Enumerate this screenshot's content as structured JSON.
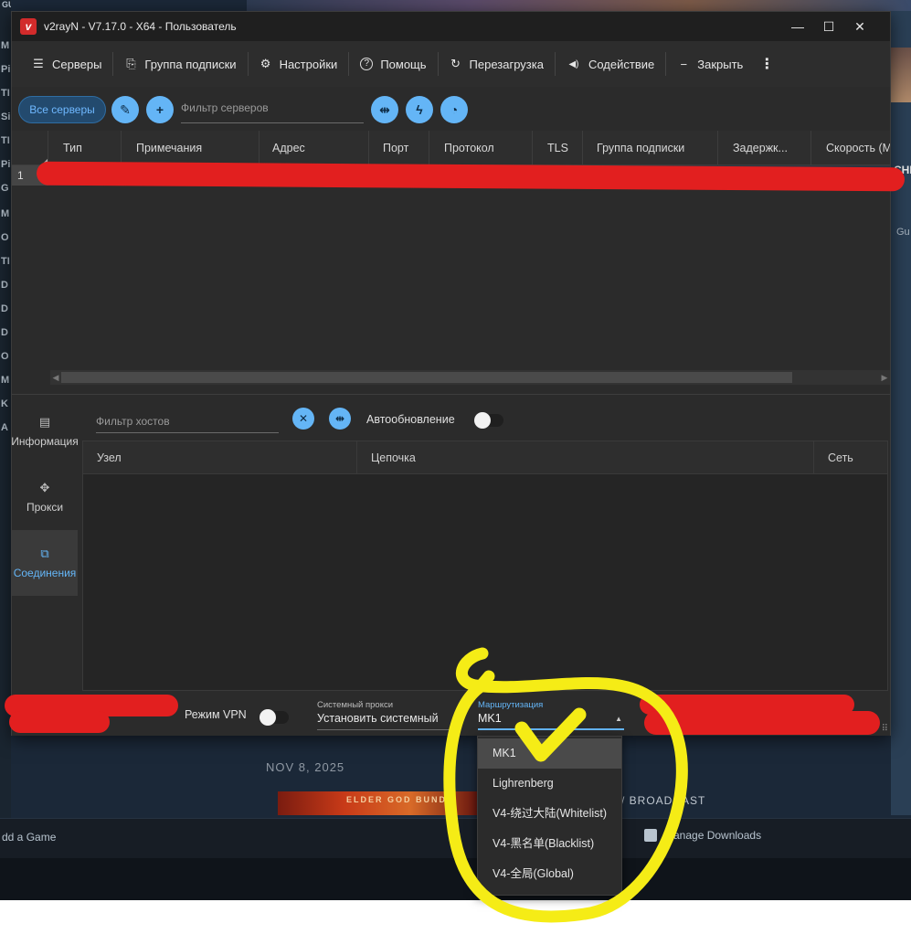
{
  "background": {
    "left_letters": [
      "M",
      "Pi",
      "TI",
      "Si",
      "TI",
      "Pi",
      "G",
      "M",
      "O",
      "TI",
      "D",
      "D",
      "D",
      "O",
      "M",
      "K",
      "A"
    ],
    "top_text": "GUILTY GEAR -STRIVE-",
    "right_partial_1": "CHI",
    "right_partial_2": "Gu",
    "date": "NOV 8, 2025",
    "card_text": "ELDER GOD BUND",
    "broadcast_text": "/ BROADCAST",
    "add_game": "dd a Game",
    "manage_downloads": "Manage Downloads"
  },
  "window": {
    "title": "v2rayN - V7.17.0 - X64 - Пользователь",
    "logo_letter": "v",
    "minimize": "—",
    "maximize": "☐",
    "close": "✕"
  },
  "toolbar": {
    "items": [
      {
        "label": "Серверы",
        "icon": "servers-icon",
        "glyph": "☰"
      },
      {
        "label": "Группа подписки",
        "icon": "subscription-icon",
        "glyph": "⎘"
      },
      {
        "label": "Настройки",
        "icon": "gear-icon",
        "glyph": "⚙"
      },
      {
        "label": "Помощь",
        "icon": "help-icon",
        "glyph": "?"
      },
      {
        "label": "Перезагрузка",
        "icon": "reload-icon",
        "glyph": "↻"
      },
      {
        "label": "Содействие",
        "icon": "speaker-icon",
        "glyph": "◀)"
      },
      {
        "label": "Закрыть",
        "icon": "minus-icon",
        "glyph": "−"
      }
    ],
    "more": "⋮"
  },
  "filterbar": {
    "all_servers": "Все серверы",
    "edit_glyph": "✎",
    "add_glyph": "+",
    "server_filter_placeholder": "Фильтр серверов",
    "move_glyph": "⇹",
    "speed_glyph": "ϟ",
    "gauge_glyph": "◔"
  },
  "servers_table": {
    "columns": [
      "Тип",
      "Примечания",
      "Адрес",
      "Порт",
      "Протокол",
      "TLS",
      "Группа подписки",
      "Задержк...",
      "Скорость (М"
    ],
    "rows": [
      {
        "index": "1"
      }
    ]
  },
  "sidenav": {
    "items": [
      {
        "label": "Информация",
        "icon": "info-icon",
        "glyph": "▤"
      },
      {
        "label": "Прокси",
        "icon": "proxy-icon",
        "glyph": "✥"
      },
      {
        "label": "Соединения",
        "icon": "connections-icon",
        "glyph": "⧉"
      }
    ]
  },
  "connections": {
    "host_filter_placeholder": "Фильтр хостов",
    "clear_glyph": "✕",
    "move_glyph": "⇹",
    "autoupdate_label": "Автообновление",
    "autoupdate_on": false,
    "columns": [
      "Узел",
      "Цепочка",
      "Сеть"
    ]
  },
  "statusbar": {
    "vpn_label": "Режим VPN",
    "vpn_on": false,
    "system_proxy_caption": "Системный прокси",
    "system_proxy_value": "Установить системный",
    "routing_caption": "Маршрутизация",
    "routing_value": "MK1"
  },
  "routing_dropdown": {
    "options": [
      "MK1",
      "Lighrenberg",
      "V4-绕过大陆(Whitelist)",
      "V4-黑名单(Blacklist)",
      "V4-全局(Global)"
    ],
    "selected": "MK1"
  },
  "colors": {
    "accent": "#64b5f6",
    "window_bg": "#2b2b2b",
    "annotation_red": "#e21f1f",
    "annotation_yellow": "#f5ec16"
  }
}
